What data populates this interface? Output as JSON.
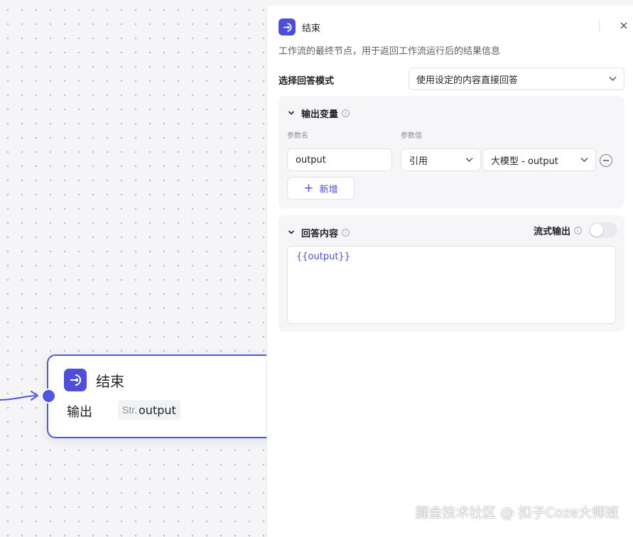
{
  "canvas": {
    "end_node": {
      "title": "结束",
      "output_label": "输出",
      "output_type": "Str.",
      "output_var": "output"
    }
  },
  "panel": {
    "title": "结束",
    "close_icon": "close-icon",
    "description": "工作流的最终节点，用于返回工作流运行后的结果信息",
    "answer_mode": {
      "label": "选择回答模式",
      "selected": "使用设定的内容直接回答"
    },
    "output_vars": {
      "title": "输出变量",
      "col_name": "参数名",
      "col_value": "参数值",
      "rows": [
        {
          "name": "output",
          "source_type": "引用",
          "source_value": "大模型 - output"
        }
      ],
      "add_label": "新增"
    },
    "answer_content": {
      "title": "回答内容",
      "stream_label": "流式输出",
      "stream_enabled": false,
      "content": "{{output}}"
    }
  },
  "watermark": "掘金技术社区 @ 扣子Coze大师班",
  "colors": {
    "accent": "#4e4fd8",
    "node_border": "#4f56e0",
    "section_bg": "#f6f6f8"
  }
}
